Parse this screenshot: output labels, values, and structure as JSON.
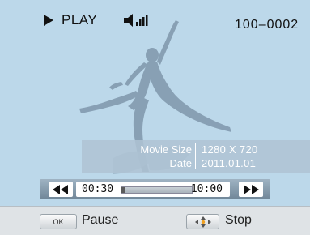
{
  "status": {
    "mode_label": "PLAY",
    "file_number": "100–0002"
  },
  "info": {
    "movie_size_label": "Movie Size",
    "movie_size_value": "1280 X 720",
    "date_label": "Date",
    "date_value": "2011.01.01"
  },
  "playback": {
    "elapsed": "00:30",
    "total": "10:00",
    "progress": 0.05
  },
  "footer": {
    "ok_key": "OK",
    "ok_action": "Pause",
    "dir_action": "Stop"
  },
  "colors": {
    "background": "#bcd8ea",
    "silhouette": "#7f97ab"
  }
}
